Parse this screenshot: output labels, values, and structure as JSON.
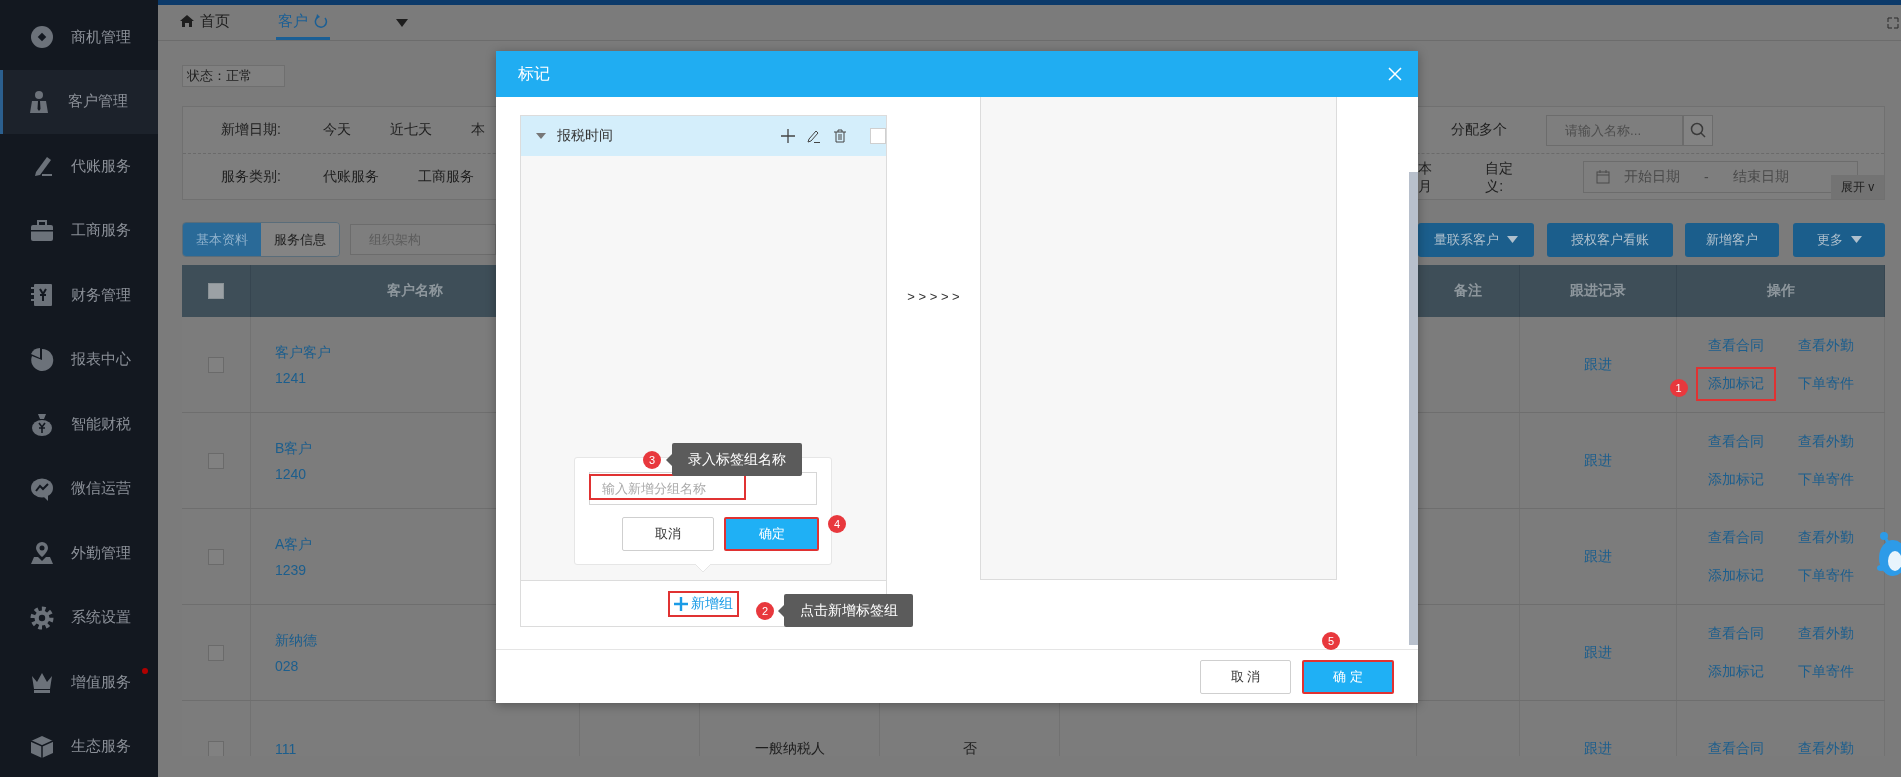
{
  "sidebar": {
    "items": [
      {
        "label": "商机管理",
        "selected": false,
        "notified": false
      },
      {
        "label": "客户管理",
        "selected": true,
        "notified": false
      },
      {
        "label": "代账服务",
        "selected": false,
        "notified": false
      },
      {
        "label": "工商服务",
        "selected": false,
        "notified": false
      },
      {
        "label": "财务管理",
        "selected": false,
        "notified": false
      },
      {
        "label": "报表中心",
        "selected": false,
        "notified": false
      },
      {
        "label": "智能财税",
        "selected": false,
        "notified": false
      },
      {
        "label": "微信运营",
        "selected": false,
        "notified": false
      },
      {
        "label": "外勤管理",
        "selected": false,
        "notified": false
      },
      {
        "label": "系统设置",
        "selected": false,
        "notified": false
      },
      {
        "label": "增值服务",
        "selected": false,
        "notified": true
      },
      {
        "label": "生态服务",
        "selected": false,
        "notified": false
      }
    ]
  },
  "tabs": [
    {
      "label": "首页",
      "selected": false
    },
    {
      "label": "客户",
      "selected": true
    }
  ],
  "status_filter": "状态：正常",
  "filters": {
    "rows": [
      {
        "label": "新增日期:",
        "options": [
          "今天",
          "近七天",
          "本"
        ]
      },
      {
        "label": "服务类别:",
        "options": [
          "代账服务",
          "工商服务"
        ]
      }
    ],
    "assign": "分配多个",
    "search": {
      "placeholder": "请输入名称..."
    },
    "period": "本月",
    "custom_label": "自定义:",
    "date_range": {
      "start_placeholder": "开始日期",
      "separator": "-",
      "end_placeholder": "结束日期"
    },
    "expand": "展开 v"
  },
  "view_toggle": [
    {
      "label": "基本资料",
      "selected": true
    },
    {
      "label": "服务信息",
      "selected": false
    }
  ],
  "org_select": {
    "placeholder": "组织架构"
  },
  "actions": [
    {
      "label": "量联系客户",
      "dropdown": true
    },
    {
      "label": "授权客户看账",
      "dropdown": false
    },
    {
      "label": "新增客户",
      "dropdown": false
    },
    {
      "label": "更多",
      "dropdown": true
    }
  ],
  "table": {
    "header_checked": false,
    "columns": [
      "客户名称",
      "备注",
      "跟进记录",
      "操作"
    ],
    "rows": [
      {
        "checked": false,
        "name_lines": [
          "客户客户",
          "1241"
        ],
        "follow": "跟进",
        "actions": [
          {
            "label": "查看合同"
          },
          {
            "label": "查看外勤"
          },
          {
            "label": "添加标记",
            "step": "1"
          },
          {
            "label": "下单寄件"
          }
        ]
      },
      {
        "checked": false,
        "name_lines": [
          "B客户",
          "1240"
        ],
        "follow": "跟进",
        "actions": [
          {
            "label": "查看合同"
          },
          {
            "label": "查看外勤"
          },
          {
            "label": "添加标记"
          },
          {
            "label": "下单寄件"
          }
        ]
      },
      {
        "checked": false,
        "name_lines": [
          "A客户",
          "1239"
        ],
        "follow": "跟进",
        "actions": [
          {
            "label": "查看合同"
          },
          {
            "label": "查看外勤"
          },
          {
            "label": "添加标记"
          },
          {
            "label": "下单寄件"
          }
        ]
      },
      {
        "checked": false,
        "name_lines": [
          "新纳德",
          "028"
        ],
        "follow": "跟进",
        "actions": [
          {
            "label": "查看合同"
          },
          {
            "label": "查看外勤"
          },
          {
            "label": "添加标记"
          },
          {
            "label": "下单寄件"
          }
        ]
      },
      {
        "checked": false,
        "name_lines": [
          "111"
        ],
        "taxpayer": "一般纳税人",
        "flag": "否",
        "follow": "跟进",
        "actions": [
          {
            "label": "查看合同"
          },
          {
            "label": "查看外勤"
          }
        ]
      }
    ]
  },
  "dialog": {
    "title": "标记",
    "groups": [
      {
        "label": "报税时间",
        "expanded": true,
        "checked": false
      }
    ],
    "transfer": "> > > > >",
    "add_group": {
      "label": "新增组",
      "step": "2",
      "hint": "点击新增标签组"
    },
    "popover": {
      "input": {
        "placeholder": "输入新增分组名称",
        "step": "3",
        "hint": "录入标签组名称"
      },
      "buttons": [
        {
          "label": "取消",
          "kind": "default"
        },
        {
          "label": "确定",
          "kind": "primary",
          "step": "4"
        }
      ]
    },
    "buttons": [
      {
        "label": "取 消",
        "kind": "default"
      },
      {
        "label": "确 定",
        "kind": "primary",
        "step": "5"
      }
    ]
  }
}
